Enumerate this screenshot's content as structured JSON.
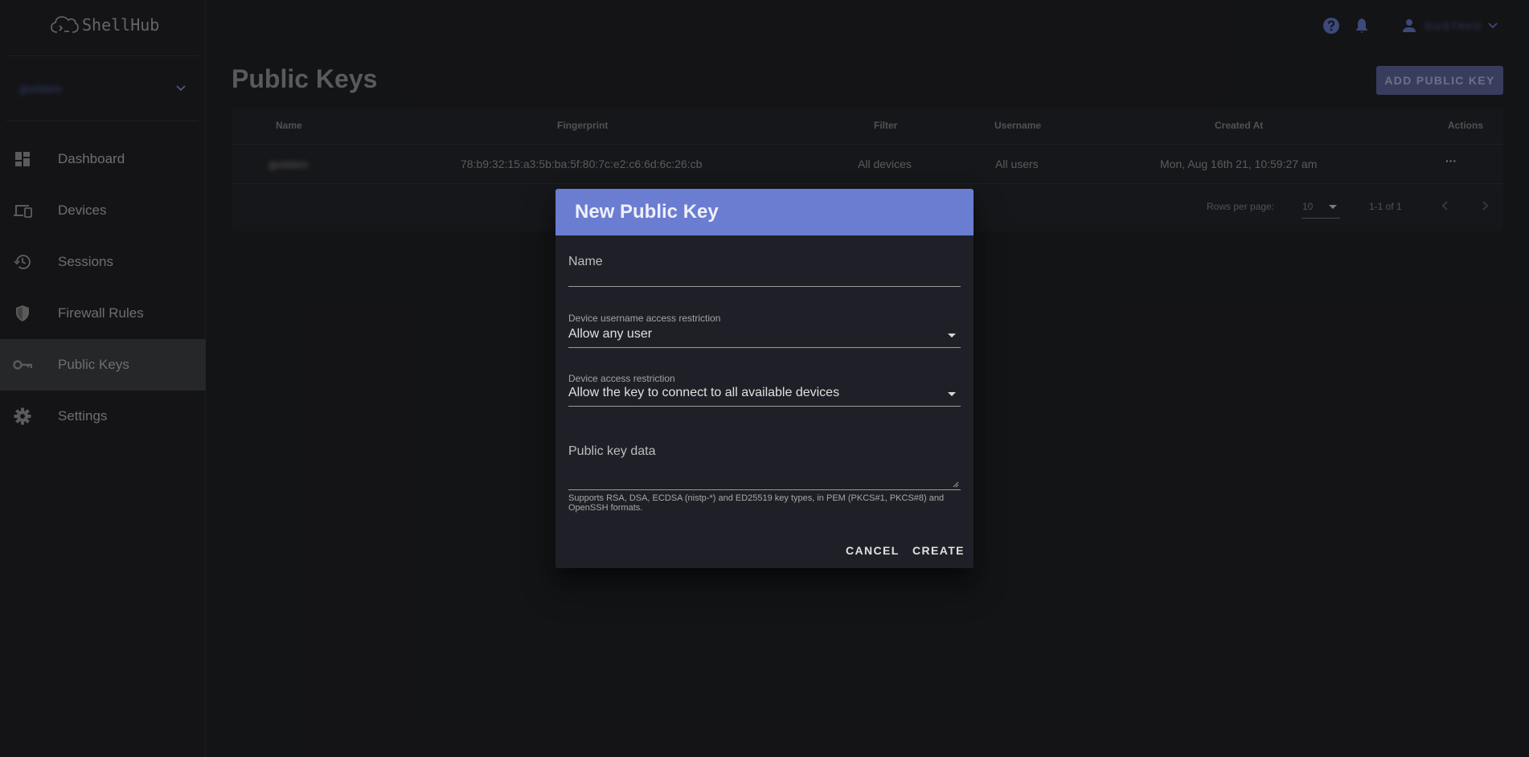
{
  "brand": {
    "logo_text": "ShellHub"
  },
  "namespace": {
    "name": "gustavo"
  },
  "sidebar": {
    "items": [
      {
        "label": "Dashboard",
        "icon": "dashboard-icon"
      },
      {
        "label": "Devices",
        "icon": "devices-icon"
      },
      {
        "label": "Sessions",
        "icon": "history-icon"
      },
      {
        "label": "Firewall Rules",
        "icon": "shield-icon"
      },
      {
        "label": "Public Keys",
        "icon": "key-icon",
        "active": true
      },
      {
        "label": "Settings",
        "icon": "gear-icon"
      }
    ]
  },
  "topbar": {
    "user_name": "GUSTAVO"
  },
  "page": {
    "title": "Public Keys",
    "add_button": "ADD PUBLIC KEY"
  },
  "table": {
    "headers": [
      "Name",
      "Fingerprint",
      "Filter",
      "Username",
      "Created At",
      "Actions"
    ],
    "rows": [
      {
        "name": "gustavo",
        "fingerprint": "78:b9:32:15:a3:5b:ba:5f:80:7c:e2:c6:6d:6c:26:cb",
        "filter": "All devices",
        "username": "All users",
        "created_at": "Mon, Aug 16th 21, 10:59:27 am",
        "actions": "···"
      }
    ],
    "footer": {
      "rows_per_page_label": "Rows per page:",
      "rows_per_page_value": "10",
      "range": "1-1 of 1"
    }
  },
  "dialog": {
    "title": "New Public Key",
    "name_placeholder": "Name",
    "username_label": "Device username access restriction",
    "username_value": "Allow any user",
    "device_label": "Device access restriction",
    "device_value": "Allow the key to connect to all available devices",
    "key_placeholder": "Public key data",
    "hint": "Supports RSA, DSA, ECDSA (nistp-*) and ED25519 key types, in PEM (PKCS#1, PKCS#8) and OpenSSH formats.",
    "cancel": "CANCEL",
    "create": "CREATE"
  },
  "colors": {
    "accent": "#6b7dd1",
    "background": "#1e1f22",
    "sidebar_active": "#3b3c40"
  }
}
